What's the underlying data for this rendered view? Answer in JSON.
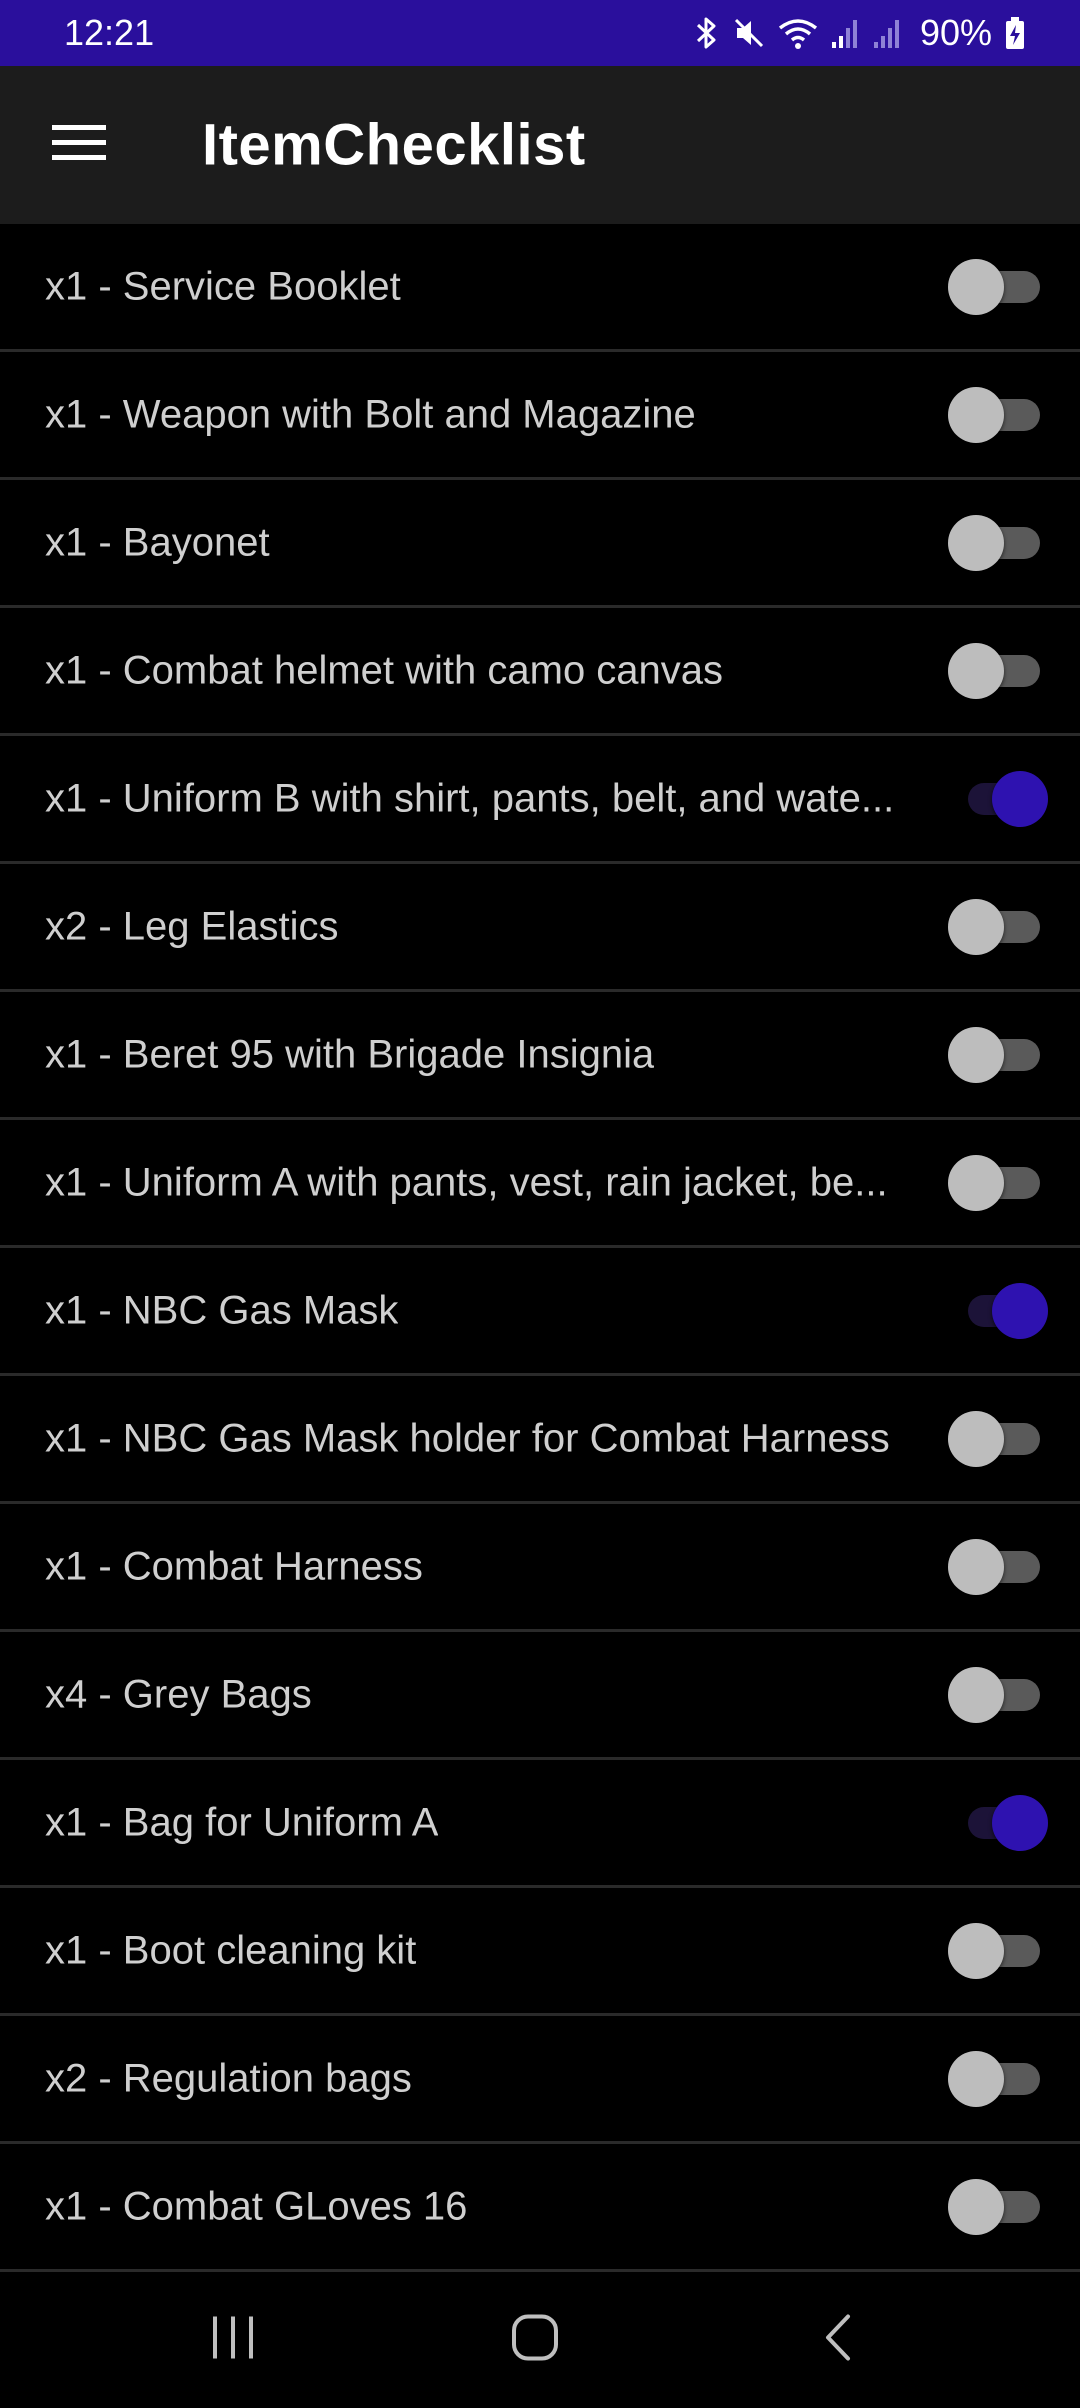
{
  "status_bar": {
    "time": "12:21",
    "battery": "90%",
    "icons": [
      "bluetooth-icon",
      "mute-icon",
      "wifi-icon",
      "signal-icon",
      "signal-icon",
      "battery-charging-icon"
    ],
    "background": "#2a0f9c"
  },
  "app_bar": {
    "title": "ItemChecklist",
    "menu_icon": "menu-icon",
    "background": "#1c1c1c"
  },
  "theme": {
    "accent": "#2e12b0",
    "toggle_off": "#bdbdbd",
    "text": "#cfcfcf"
  },
  "items": [
    {
      "label": "x1 - Service Booklet",
      "checked": false
    },
    {
      "label": "x1 - Weapon with Bolt and Magazine",
      "checked": false
    },
    {
      "label": "x1 - Bayonet",
      "checked": false
    },
    {
      "label": "x1 - Combat helmet with camo canvas",
      "checked": false
    },
    {
      "label": "x1 - Uniform B with shirt, pants, belt, and wate...",
      "checked": true
    },
    {
      "label": "x2 - Leg Elastics",
      "checked": false
    },
    {
      "label": "x1 - Beret 95 with Brigade Insignia",
      "checked": false
    },
    {
      "label": "x1 - Uniform A with pants, vest, rain jacket, be...",
      "checked": false
    },
    {
      "label": "x1 - NBC Gas Mask",
      "checked": true
    },
    {
      "label": "x1 - NBC Gas Mask holder for Combat Harness",
      "checked": false
    },
    {
      "label": "x1 - Combat Harness",
      "checked": false
    },
    {
      "label": "x4 - Grey Bags",
      "checked": false
    },
    {
      "label": "x1 - Bag for Uniform A",
      "checked": true
    },
    {
      "label": "x1 - Boot cleaning kit",
      "checked": false
    },
    {
      "label": "x2 - Regulation bags",
      "checked": false
    },
    {
      "label": "x1 - Combat GLoves 16",
      "checked": false
    }
  ],
  "nav_bar": {
    "buttons": [
      "recent-apps-icon",
      "home-icon",
      "back-icon"
    ]
  }
}
